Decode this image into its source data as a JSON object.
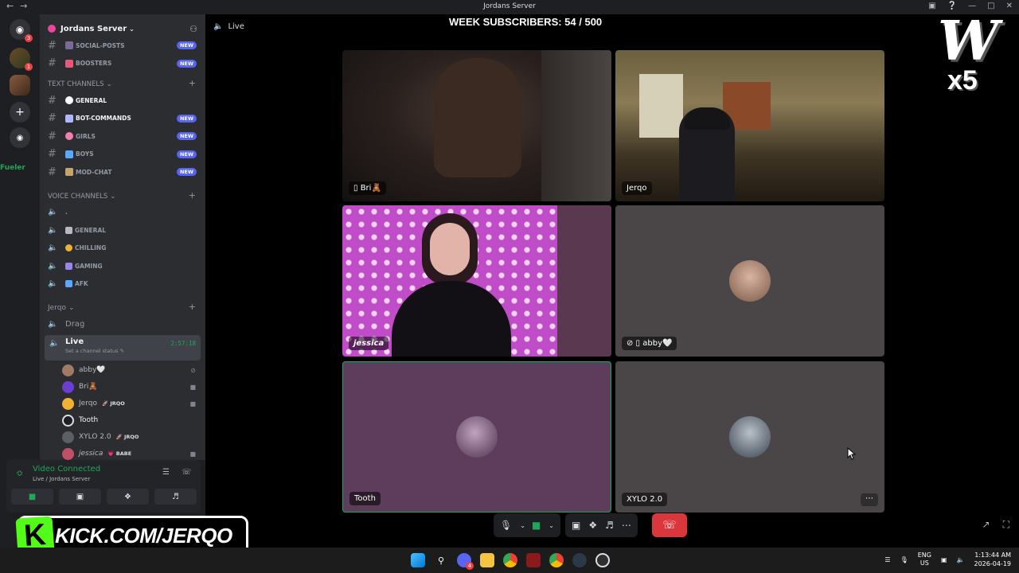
{
  "window": {
    "title": "Jordans Server"
  },
  "server": {
    "name": "Jordans Server",
    "rail_badges": [
      "3",
      "1"
    ]
  },
  "text_top": [
    {
      "name": "SOCIAL-POSTS",
      "badge": "NEW"
    },
    {
      "name": "BOOSTERS",
      "badge": "NEW"
    }
  ],
  "text_category": "TEXT CHANNELS",
  "text_channels": [
    {
      "name": "GENERAL",
      "badge": ""
    },
    {
      "name": "BOT-COMMANDS",
      "badge": "NEW"
    },
    {
      "name": "GIRLS",
      "badge": "NEW"
    },
    {
      "name": "BOYS",
      "badge": "NEW"
    },
    {
      "name": "MOD-CHAT",
      "badge": "NEW"
    }
  ],
  "voice_category": "VOICE CHANNELS",
  "voice_channels": [
    ".",
    "GENERAL",
    "CHILLING",
    "GAMING",
    "AFK"
  ],
  "jerqo_category": "Jerqo",
  "drag_channel": "Drag",
  "live_channel": {
    "name": "Live",
    "status": "Set a channel status",
    "timer": "2:57:18"
  },
  "members": [
    {
      "name": "abby🤍",
      "tag": "",
      "right": "⊘"
    },
    {
      "name": "Bri🧸",
      "tag": "",
      "right": "■"
    },
    {
      "name": "Jerqo",
      "tag": "JRQO",
      "right": "■"
    },
    {
      "name": "Tooth",
      "tag": "",
      "right": ""
    },
    {
      "name": "XYLO 2.0",
      "tag": "JRQO",
      "right": ""
    },
    {
      "name": "jessica",
      "tag": "BABE",
      "right": "■"
    }
  ],
  "overlay": {
    "fueler": "Fueler",
    "subs": "WEEK SUBSCRIBERS: 54 / 500",
    "logo_letter": "W",
    "logo_mult": "x5",
    "kick_letter": "K",
    "kick_text": "KICK.COM/JERQO"
  },
  "voice_panel": {
    "title": "Video Connected",
    "subtitle": "Live / Jordans Server"
  },
  "stage": {
    "channel_label": "Live"
  },
  "tiles": [
    {
      "label": "Bri🧸",
      "style": "dark-room"
    },
    {
      "label": "Jerqo",
      "style": "hallway"
    },
    {
      "label": "jessica",
      "style": "pink-lights"
    },
    {
      "label": "abby🤍",
      "style": "avatar"
    },
    {
      "label": "Tooth",
      "style": "avatar-purple"
    },
    {
      "label": "XYLO 2.0",
      "style": "avatar"
    }
  ],
  "taskbar": {
    "lang_top": "ENG",
    "lang_bottom": "US",
    "time": "1:13:44 AM",
    "date": "2026-04-19",
    "discord_badge": "4"
  },
  "colors": {
    "accent": "#5865f2",
    "connected": "#23a559",
    "hangup": "#da373c",
    "kick_green": "#53fc18"
  }
}
